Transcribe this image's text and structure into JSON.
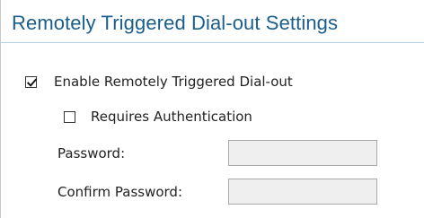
{
  "section": {
    "title": "Remotely Triggered Dial-out Settings"
  },
  "options": {
    "enable_dialout": {
      "label": "Enable Remotely Triggered Dial-out",
      "checked": true
    },
    "requires_auth": {
      "label": "Requires Authentication",
      "checked": false
    }
  },
  "fields": {
    "password": {
      "label": "Password:",
      "value": ""
    },
    "confirm_password": {
      "label": "Confirm Password:",
      "value": ""
    }
  },
  "colors": {
    "title": "#1a5e8e",
    "input_background": "#efefef",
    "input_border": "#a9a9a9"
  }
}
